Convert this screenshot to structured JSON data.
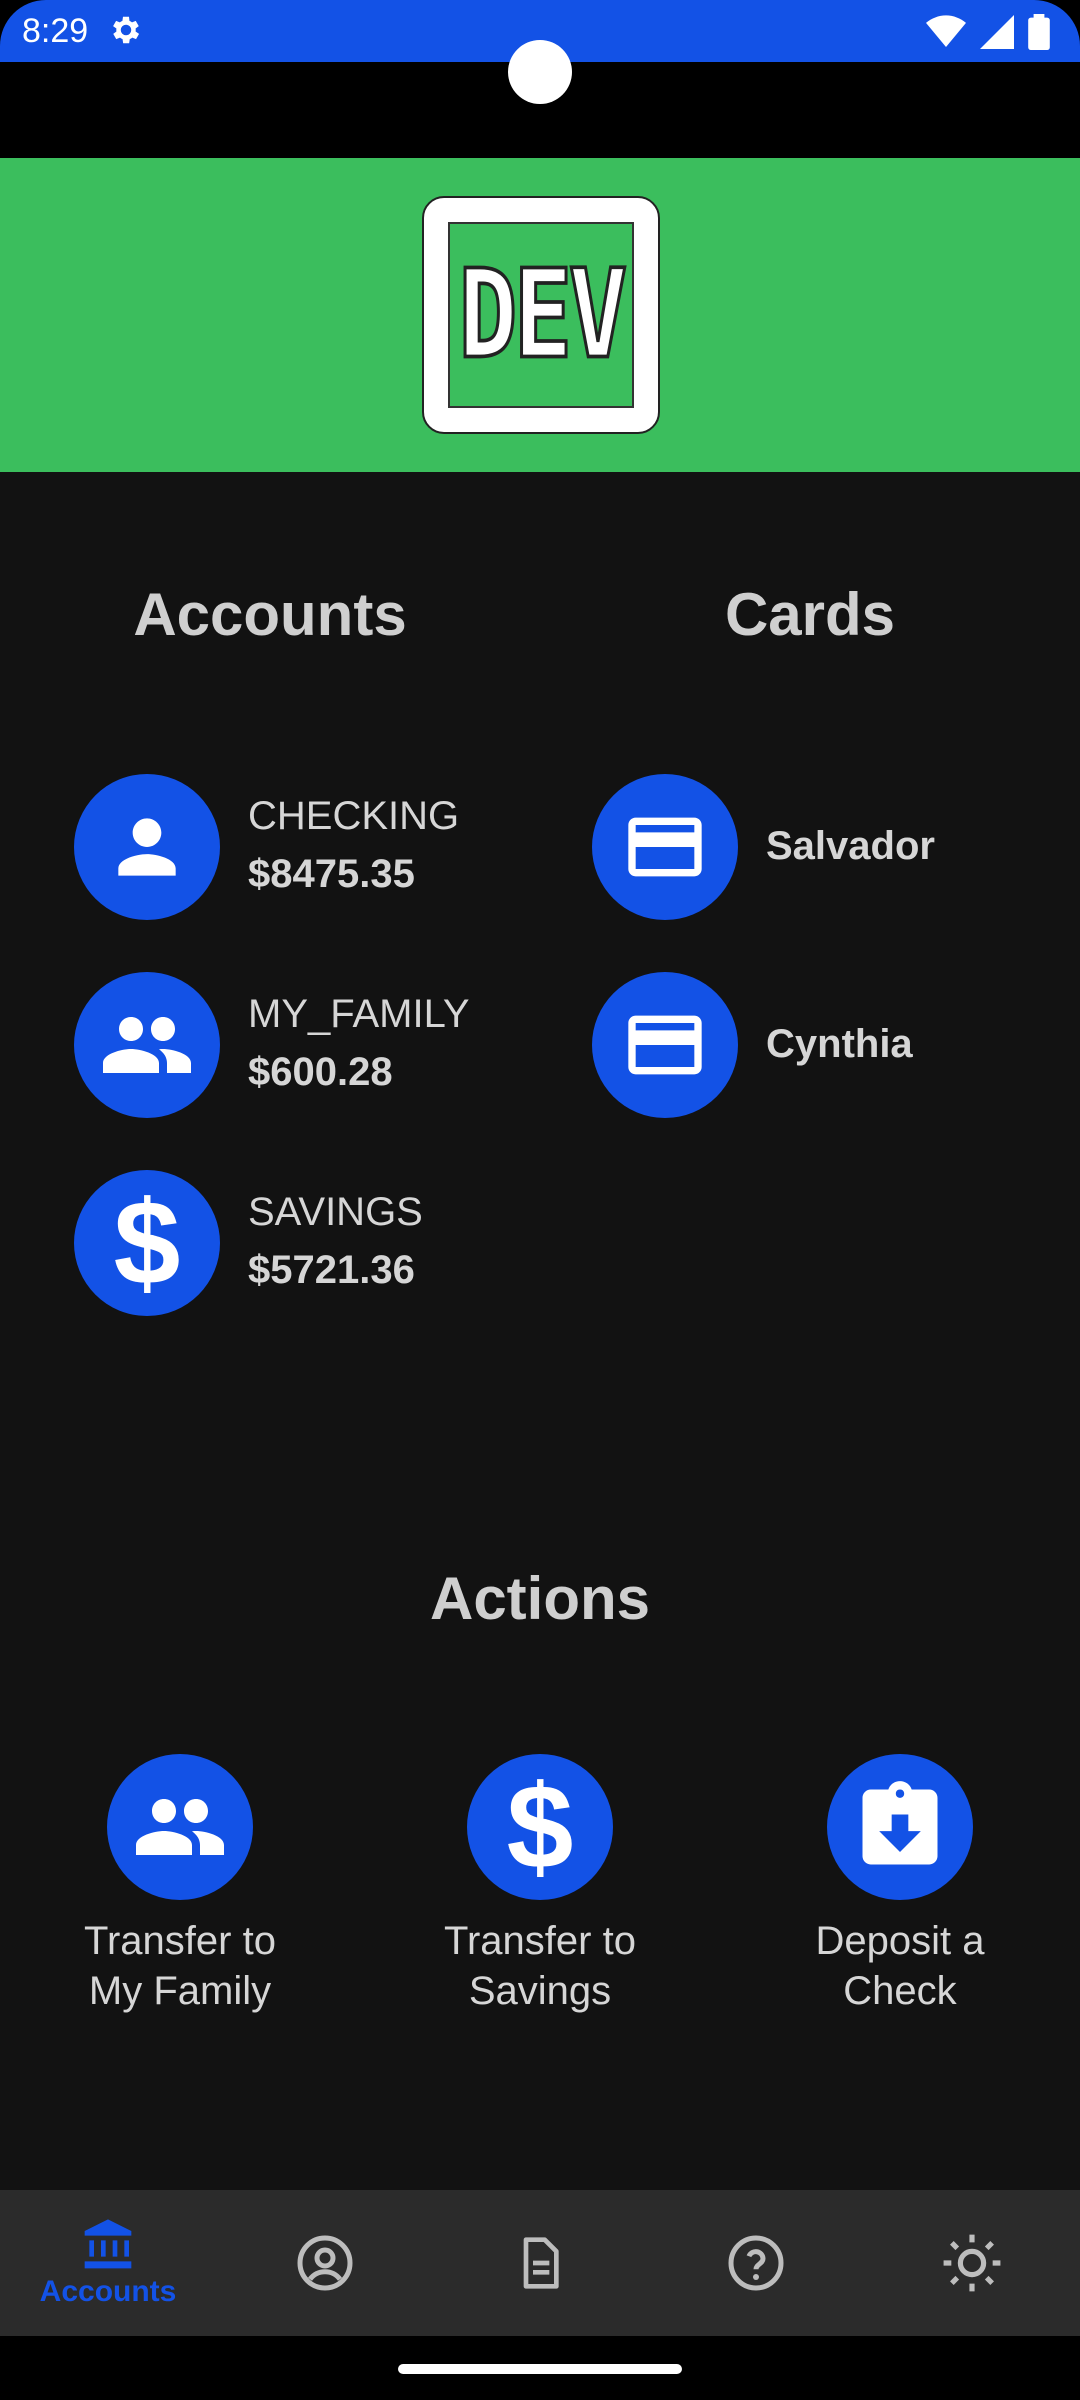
{
  "status_bar": {
    "time": "8:29"
  },
  "logo": {
    "text": "DEV"
  },
  "sections": {
    "accounts": "Accounts",
    "cards": "Cards",
    "actions": "Actions"
  },
  "accounts": [
    {
      "name": "CHECKING",
      "balance": "$8475.35",
      "icon": "person-icon"
    },
    {
      "name": "MY_FAMILY",
      "balance": "$600.28",
      "icon": "group-icon"
    },
    {
      "name": "SAVINGS",
      "balance": "$5721.36",
      "icon": "dollar-icon"
    }
  ],
  "cards": [
    {
      "name": "Salvador",
      "icon": "credit-card-icon"
    },
    {
      "name": "Cynthia",
      "icon": "credit-card-icon"
    }
  ],
  "actions": [
    {
      "line1": "Transfer to",
      "line2": "My Family",
      "icon": "group-icon"
    },
    {
      "line1": "Transfer to",
      "line2": "Savings",
      "icon": "dollar-icon"
    },
    {
      "line1": "Deposit a",
      "line2": "Check",
      "icon": "clipboard-download-icon"
    }
  ],
  "bottom_nav": {
    "active_label": "Accounts",
    "items": [
      "bank-icon",
      "account-circle-icon",
      "document-icon",
      "help-icon",
      "brightness-icon"
    ]
  },
  "colors": {
    "accent": "#1352E6",
    "banner": "#3BBE5D",
    "background": "#121212",
    "nav": "#2B2B2B"
  }
}
